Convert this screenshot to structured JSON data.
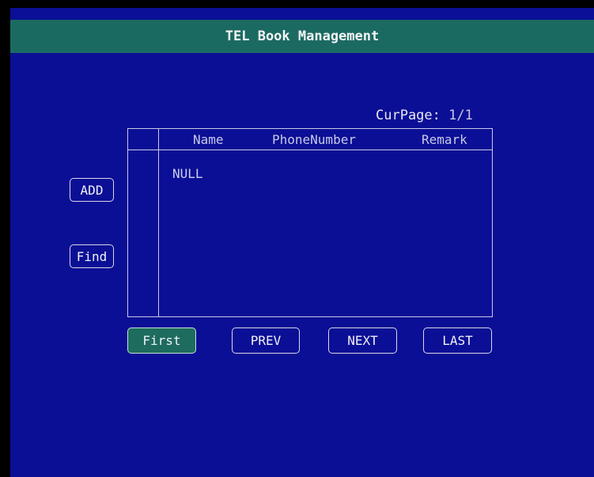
{
  "title": "TEL Book Management",
  "pagination": {
    "label": "CurPage:",
    "value": "1/1"
  },
  "side_buttons": {
    "add": "ADD",
    "find": "Find"
  },
  "table": {
    "columns": [
      "Name",
      "PhoneNumber",
      "Remark"
    ],
    "rows": [
      {
        "name": "NULL",
        "phone": "",
        "remark": ""
      }
    ]
  },
  "nav_buttons": {
    "first": "First",
    "prev": "PREV",
    "next": "NEXT",
    "last": "LAST",
    "selected": "First"
  },
  "colors": {
    "background": "#0b0f95",
    "title_bar": "#1b6a62",
    "selected_button": "#1e6c5e",
    "text": "#e8e8f0"
  }
}
